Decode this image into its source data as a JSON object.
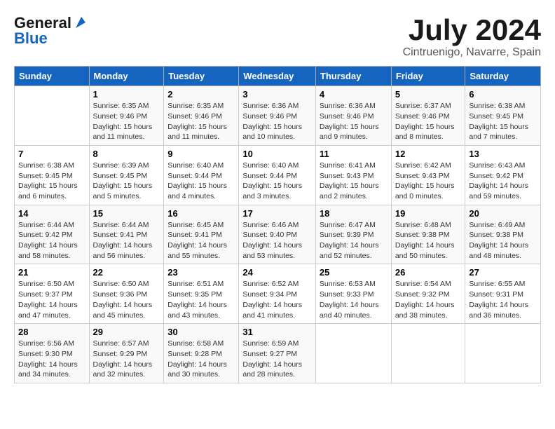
{
  "header": {
    "logo_general": "General",
    "logo_blue": "Blue",
    "month_title": "July 2024",
    "location": "Cintruenigo, Navarre, Spain"
  },
  "days_of_week": [
    "Sunday",
    "Monday",
    "Tuesday",
    "Wednesday",
    "Thursday",
    "Friday",
    "Saturday"
  ],
  "weeks": [
    [
      {
        "day": "",
        "info": ""
      },
      {
        "day": "1",
        "info": "Sunrise: 6:35 AM\nSunset: 9:46 PM\nDaylight: 15 hours\nand 11 minutes."
      },
      {
        "day": "2",
        "info": "Sunrise: 6:35 AM\nSunset: 9:46 PM\nDaylight: 15 hours\nand 11 minutes."
      },
      {
        "day": "3",
        "info": "Sunrise: 6:36 AM\nSunset: 9:46 PM\nDaylight: 15 hours\nand 10 minutes."
      },
      {
        "day": "4",
        "info": "Sunrise: 6:36 AM\nSunset: 9:46 PM\nDaylight: 15 hours\nand 9 minutes."
      },
      {
        "day": "5",
        "info": "Sunrise: 6:37 AM\nSunset: 9:46 PM\nDaylight: 15 hours\nand 8 minutes."
      },
      {
        "day": "6",
        "info": "Sunrise: 6:38 AM\nSunset: 9:45 PM\nDaylight: 15 hours\nand 7 minutes."
      }
    ],
    [
      {
        "day": "7",
        "info": "Sunrise: 6:38 AM\nSunset: 9:45 PM\nDaylight: 15 hours\nand 6 minutes."
      },
      {
        "day": "8",
        "info": "Sunrise: 6:39 AM\nSunset: 9:45 PM\nDaylight: 15 hours\nand 5 minutes."
      },
      {
        "day": "9",
        "info": "Sunrise: 6:40 AM\nSunset: 9:44 PM\nDaylight: 15 hours\nand 4 minutes."
      },
      {
        "day": "10",
        "info": "Sunrise: 6:40 AM\nSunset: 9:44 PM\nDaylight: 15 hours\nand 3 minutes."
      },
      {
        "day": "11",
        "info": "Sunrise: 6:41 AM\nSunset: 9:43 PM\nDaylight: 15 hours\nand 2 minutes."
      },
      {
        "day": "12",
        "info": "Sunrise: 6:42 AM\nSunset: 9:43 PM\nDaylight: 15 hours\nand 0 minutes."
      },
      {
        "day": "13",
        "info": "Sunrise: 6:43 AM\nSunset: 9:42 PM\nDaylight: 14 hours\nand 59 minutes."
      }
    ],
    [
      {
        "day": "14",
        "info": "Sunrise: 6:44 AM\nSunset: 9:42 PM\nDaylight: 14 hours\nand 58 minutes."
      },
      {
        "day": "15",
        "info": "Sunrise: 6:44 AM\nSunset: 9:41 PM\nDaylight: 14 hours\nand 56 minutes."
      },
      {
        "day": "16",
        "info": "Sunrise: 6:45 AM\nSunset: 9:41 PM\nDaylight: 14 hours\nand 55 minutes."
      },
      {
        "day": "17",
        "info": "Sunrise: 6:46 AM\nSunset: 9:40 PM\nDaylight: 14 hours\nand 53 minutes."
      },
      {
        "day": "18",
        "info": "Sunrise: 6:47 AM\nSunset: 9:39 PM\nDaylight: 14 hours\nand 52 minutes."
      },
      {
        "day": "19",
        "info": "Sunrise: 6:48 AM\nSunset: 9:38 PM\nDaylight: 14 hours\nand 50 minutes."
      },
      {
        "day": "20",
        "info": "Sunrise: 6:49 AM\nSunset: 9:38 PM\nDaylight: 14 hours\nand 48 minutes."
      }
    ],
    [
      {
        "day": "21",
        "info": "Sunrise: 6:50 AM\nSunset: 9:37 PM\nDaylight: 14 hours\nand 47 minutes."
      },
      {
        "day": "22",
        "info": "Sunrise: 6:50 AM\nSunset: 9:36 PM\nDaylight: 14 hours\nand 45 minutes."
      },
      {
        "day": "23",
        "info": "Sunrise: 6:51 AM\nSunset: 9:35 PM\nDaylight: 14 hours\nand 43 minutes."
      },
      {
        "day": "24",
        "info": "Sunrise: 6:52 AM\nSunset: 9:34 PM\nDaylight: 14 hours\nand 41 minutes."
      },
      {
        "day": "25",
        "info": "Sunrise: 6:53 AM\nSunset: 9:33 PM\nDaylight: 14 hours\nand 40 minutes."
      },
      {
        "day": "26",
        "info": "Sunrise: 6:54 AM\nSunset: 9:32 PM\nDaylight: 14 hours\nand 38 minutes."
      },
      {
        "day": "27",
        "info": "Sunrise: 6:55 AM\nSunset: 9:31 PM\nDaylight: 14 hours\nand 36 minutes."
      }
    ],
    [
      {
        "day": "28",
        "info": "Sunrise: 6:56 AM\nSunset: 9:30 PM\nDaylight: 14 hours\nand 34 minutes."
      },
      {
        "day": "29",
        "info": "Sunrise: 6:57 AM\nSunset: 9:29 PM\nDaylight: 14 hours\nand 32 minutes."
      },
      {
        "day": "30",
        "info": "Sunrise: 6:58 AM\nSunset: 9:28 PM\nDaylight: 14 hours\nand 30 minutes."
      },
      {
        "day": "31",
        "info": "Sunrise: 6:59 AM\nSunset: 9:27 PM\nDaylight: 14 hours\nand 28 minutes."
      },
      {
        "day": "",
        "info": ""
      },
      {
        "day": "",
        "info": ""
      },
      {
        "day": "",
        "info": ""
      }
    ]
  ]
}
